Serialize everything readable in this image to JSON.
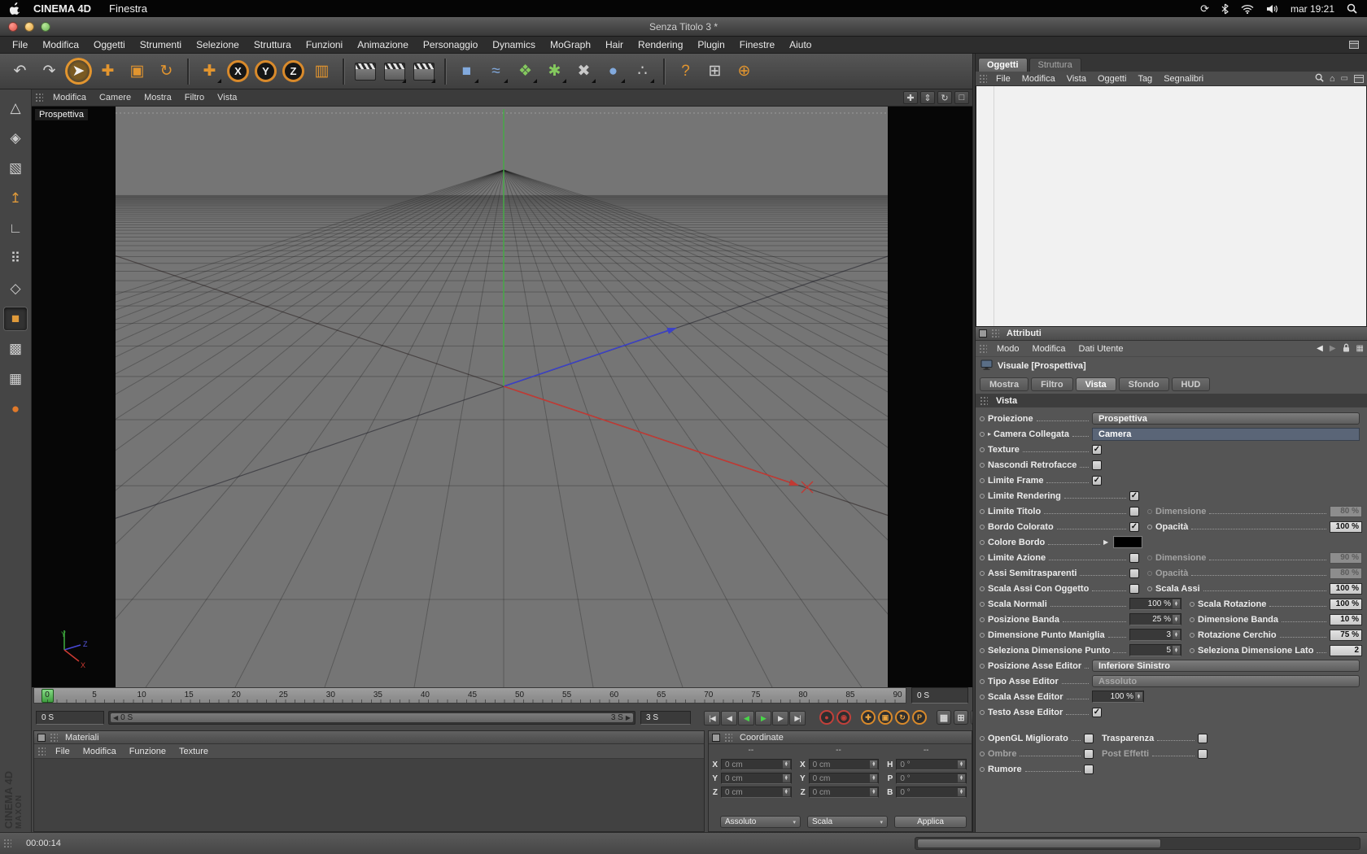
{
  "macos": {
    "app_name": "CINEMA 4D",
    "menu_items": [
      "Finestra"
    ],
    "clock": "mar 19:21",
    "status_icons": [
      "sync-icon",
      "bluetooth-icon",
      "wifi-icon",
      "volume-icon",
      "spotlight-icon"
    ]
  },
  "window": {
    "title": "Senza Titolo 3 *"
  },
  "main_menu": [
    "File",
    "Modifica",
    "Oggetti",
    "Strumenti",
    "Selezione",
    "Struttura",
    "Funzioni",
    "Animazione",
    "Personaggio",
    "Dynamics",
    "MoGraph",
    "Hair",
    "Rendering",
    "Plugin",
    "Finestre",
    "Aiuto"
  ],
  "toolbar": [
    {
      "name": "undo-button",
      "glyph": "↶",
      "kind": "plain"
    },
    {
      "name": "redo-button",
      "glyph": "↷",
      "kind": "plain"
    },
    {
      "name": "live-selection-tool-button",
      "glyph": "➤",
      "kind": "active-tool"
    },
    {
      "name": "move-tool-button",
      "glyph": "✚",
      "kind": "tool"
    },
    {
      "name": "scale-tool-button",
      "glyph": "▣",
      "kind": "tool"
    },
    {
      "name": "rotate-tool-button",
      "glyph": "↻",
      "kind": "tool"
    },
    {
      "sep": true
    },
    {
      "name": "last-used-tool-button",
      "glyph": "✚",
      "kind": "tool",
      "corner": true
    },
    {
      "name": "lock-x-axis-button",
      "glyph": "X",
      "kind": "axis"
    },
    {
      "name": "lock-y-axis-button",
      "glyph": "Y",
      "kind": "axis"
    },
    {
      "name": "lock-z-axis-button",
      "glyph": "Z",
      "kind": "axis"
    },
    {
      "name": "coordinate-system-button",
      "glyph": "▥",
      "kind": "tool"
    },
    {
      "sep": true
    },
    {
      "name": "render-view-button",
      "kind": "clapper"
    },
    {
      "name": "render-settings-button",
      "kind": "clapper",
      "corner": true
    },
    {
      "name": "render-picture-viewer-button",
      "kind": "clapper",
      "corner": true
    },
    {
      "sep": true
    },
    {
      "name": "add-primitive-button",
      "glyph": "■",
      "kind": "blue",
      "corner": true
    },
    {
      "name": "add-spline-button",
      "glyph": "≈",
      "kind": "blue",
      "corner": true
    },
    {
      "name": "add-generator-button",
      "glyph": "❖",
      "kind": "green",
      "corner": true
    },
    {
      "name": "add-modeling-button",
      "glyph": "✱",
      "kind": "green",
      "corner": true
    },
    {
      "name": "add-deformer-button",
      "glyph": "✖",
      "kind": "gray",
      "corner": true
    },
    {
      "name": "add-environment-button",
      "glyph": "●",
      "kind": "blue",
      "corner": true
    },
    {
      "name": "add-particles-button",
      "glyph": "∴",
      "kind": "gray",
      "corner": true
    },
    {
      "sep": true
    },
    {
      "name": "help-button",
      "glyph": "?",
      "kind": "tool"
    },
    {
      "name": "content-browser-button",
      "glyph": "⊞",
      "kind": "plain"
    },
    {
      "name": "online-updater-button",
      "glyph": "⊕",
      "kind": "tool"
    }
  ],
  "left_toolbar": [
    {
      "name": "make-editable-button",
      "glyph": "△",
      "color": "#d8d8d8"
    },
    {
      "name": "model-mode-button",
      "glyph": "◈",
      "color": "#cfcfcf"
    },
    {
      "name": "texture-mode-button",
      "glyph": "▧",
      "color": "#cfcfcf"
    },
    {
      "name": "object-axis-mode-button",
      "glyph": "↥",
      "color": "#e09a3a"
    },
    {
      "name": "ruler-mode-button",
      "glyph": "∟",
      "color": "#cfcfcf"
    },
    {
      "name": "points-mode-button",
      "glyph": "⠿",
      "color": "#cfcfcf"
    },
    {
      "name": "edges-mode-button",
      "glyph": "◇",
      "color": "#cfcfcf"
    },
    {
      "name": "polygons-mode-button",
      "glyph": "■",
      "color": "#e09a3a",
      "pressed": true
    },
    {
      "name": "texture-axis-mode-button",
      "glyph": "▩",
      "color": "#cfcfcf"
    },
    {
      "name": "workplane-button",
      "glyph": "▦",
      "color": "#cfcfcf"
    },
    {
      "name": "viewport-solo-button",
      "glyph": "●",
      "color": "#e0792a"
    }
  ],
  "viewport": {
    "menus": [
      "Modifica",
      "Camere",
      "Mostra",
      "Filtro",
      "Vista"
    ],
    "camera_label": "Prospettiva",
    "nav_icons": [
      {
        "name": "pan-view-icon",
        "glyph": "✚"
      },
      {
        "name": "zoom-view-icon",
        "glyph": "⇕"
      },
      {
        "name": "rotate-view-icon",
        "glyph": "↻"
      },
      {
        "name": "toggle-view-icon",
        "glyph": "□"
      }
    ],
    "axis_labels": {
      "x": "X",
      "y": "Y",
      "z": "Z"
    }
  },
  "timeline": {
    "ticks": [
      "0",
      "5",
      "10",
      "15",
      "20",
      "25",
      "30",
      "35",
      "40",
      "45",
      "50",
      "55",
      "60",
      "65",
      "70",
      "75",
      "80",
      "85",
      "90"
    ],
    "frame_field": "0 S",
    "current_time": "0 S",
    "range_start": "0 S",
    "range_end": "3 S",
    "end_time": "3 S",
    "playback": [
      {
        "name": "goto-start-button",
        "glyph": "|◀"
      },
      {
        "name": "previous-frame-button",
        "glyph": "◀"
      },
      {
        "name": "play-backwards-button",
        "glyph": "◀",
        "green": true
      },
      {
        "name": "play-forwards-button",
        "glyph": "▶",
        "green": true
      },
      {
        "name": "next-frame-button",
        "glyph": "▶"
      },
      {
        "name": "goto-end-button",
        "glyph": "▶|"
      }
    ],
    "record_buttons": [
      {
        "name": "record-keyframe-button",
        "kind": "red",
        "glyph": "●"
      },
      {
        "name": "autokeying-button",
        "kind": "red",
        "glyph": "◉"
      },
      {
        "gap": true
      },
      {
        "name": "keyframe-position-toggle",
        "kind": "orange",
        "glyph": "✚"
      },
      {
        "name": "keyframe-scale-toggle",
        "kind": "orange",
        "glyph": "▣"
      },
      {
        "name": "keyframe-rotation-toggle",
        "kind": "orange",
        "glyph": "↻"
      },
      {
        "name": "keyframe-parameter-toggle",
        "kind": "orange",
        "glyph": "P"
      },
      {
        "gap": true
      },
      {
        "name": "keyframe-pla-toggle",
        "kind": "gray",
        "glyph": "▦"
      },
      {
        "name": "snap-settings-button",
        "kind": "gray",
        "glyph": "⊞"
      },
      {
        "name": "timeline-options-button",
        "kind": "gray",
        "glyph": "▤"
      }
    ]
  },
  "materials": {
    "title": "Materiali",
    "menus": [
      "File",
      "Modifica",
      "Funzione",
      "Texture"
    ]
  },
  "coordinates": {
    "title": "Coordinate",
    "columns": [
      {
        "header": "--",
        "rows": [
          [
            "X",
            "0 cm"
          ],
          [
            "Y",
            "0 cm"
          ],
          [
            "Z",
            "0 cm"
          ]
        ]
      },
      {
        "header": "--",
        "rows": [
          [
            "X",
            "0 cm"
          ],
          [
            "Y",
            "0 cm"
          ],
          [
            "Z",
            "0 cm"
          ]
        ]
      },
      {
        "header": "--",
        "rows": [
          [
            "H",
            "0 °"
          ],
          [
            "P",
            "0 °"
          ],
          [
            "B",
            "0 °"
          ]
        ]
      }
    ],
    "mode_dropdown": "Assoluto",
    "scale_dropdown": "Scala",
    "apply_button": "Applica"
  },
  "object_manager": {
    "tabs": [
      {
        "label": "Oggetti",
        "active": true
      },
      {
        "label": "Struttura",
        "active": false
      }
    ],
    "menus": [
      "File",
      "Modifica",
      "Vista",
      "Oggetti",
      "Tag",
      "Segnalibri"
    ]
  },
  "attributes": {
    "title": "Attributi",
    "menus": [
      "Modo",
      "Modifica",
      "Dati Utente"
    ],
    "object_label": "Visuale [Prospettiva]",
    "tabs": [
      "Mostra",
      "Filtro",
      "Vista",
      "Sfondo",
      "HUD"
    ],
    "active_tab": "Vista",
    "section": "Vista",
    "rows": [
      {
        "label": "Proiezione",
        "variant": "dd",
        "control": "dropdown",
        "value": "Prospettiva"
      },
      {
        "label": "Camera Collegata",
        "variant": "dd",
        "expander": true,
        "control": "dropdown_selected",
        "value": "Camera"
      },
      {
        "label": "Texture",
        "variant": "dd",
        "control": "checkbox",
        "checked": true
      },
      {
        "label": "Nascondi Retrofacce",
        "variant": "dd",
        "control": "checkbox",
        "checked": false
      },
      {
        "label": "Limite Frame",
        "variant": "dd",
        "control": "checkbox",
        "checked": true
      },
      {
        "label": "Limite Rendering",
        "control": "checkbox",
        "checked": true
      },
      {
        "label": "Limite Titolo",
        "control": "checkbox",
        "checked": false,
        "right": {
          "label": "Dimensione",
          "value": "80 %",
          "disabled": true
        }
      },
      {
        "label": "Bordo Colorato",
        "control": "checkbox",
        "checked": true,
        "right": {
          "label": "Opacità",
          "value": "100 %"
        }
      },
      {
        "label": "Colore Bordo",
        "variant": "colorrow",
        "control": "color",
        "value": "#000000"
      },
      {
        "label": "Limite Azione",
        "control": "checkbox",
        "checked": false,
        "right": {
          "label": "Dimensione",
          "value": "90 %",
          "disabled": true
        }
      },
      {
        "label": "Assi Semitrasparenti",
        "control": "checkbox",
        "checked": false,
        "right": {
          "label": "Opacità",
          "value": "80 %",
          "disabled": true
        }
      },
      {
        "label": "Scala Assi Con Oggetto",
        "control": "checkbox",
        "checked": false,
        "right": {
          "label": "Scala Assi",
          "value": "100 %"
        }
      },
      {
        "label": "Scala Normali",
        "control": "stepper",
        "value": "100 %",
        "right": {
          "label": "Scala Rotazione",
          "value": "100 %"
        }
      },
      {
        "label": "Posizione Banda",
        "control": "stepper",
        "value": "25 %",
        "right": {
          "label": "Dimensione Banda",
          "value": "10 %"
        }
      },
      {
        "label": "Dimensione Punto Maniglia",
        "control": "stepper",
        "value": "3",
        "right": {
          "label": "Rotazione Cerchio",
          "value": "75 %"
        }
      },
      {
        "label": "Seleziona Dimensione Punto",
        "control": "stepper",
        "value": "5",
        "right": {
          "label": "Seleziona Dimensione Lato",
          "value": "2"
        }
      },
      {
        "label": "Posizione Asse Editor",
        "variant": "dd",
        "control": "dropdown",
        "value": "Inferiore Sinistro"
      },
      {
        "label": "Tipo Asse Editor",
        "variant": "dd",
        "control": "dropdown",
        "value": "Assoluto",
        "disabled": true
      },
      {
        "label": "Scala Asse Editor",
        "variant": "dd",
        "control": "stepper",
        "value": "100 %"
      },
      {
        "label": "Testo Asse Editor",
        "variant": "dd",
        "control": "checkbox",
        "checked": true
      },
      {
        "label": "OpenGL Migliorato",
        "variant": "half",
        "gap": true,
        "control": "checkbox",
        "checked": false,
        "pair": {
          "label": "Trasparenza",
          "checked": false
        }
      },
      {
        "label": "Ombre",
        "variant": "half",
        "dim": true,
        "control": "checkbox",
        "checked": false,
        "pair": {
          "label": "Post Effetti",
          "checked": false,
          "dim": true
        }
      },
      {
        "label": "Rumore",
        "variant": "half",
        "control": "checkbox",
        "checked": false
      }
    ]
  },
  "statusbar": {
    "time": "00:00:14"
  },
  "branding": {
    "line1": "MAXON",
    "line2": "CINEMA 4D"
  }
}
